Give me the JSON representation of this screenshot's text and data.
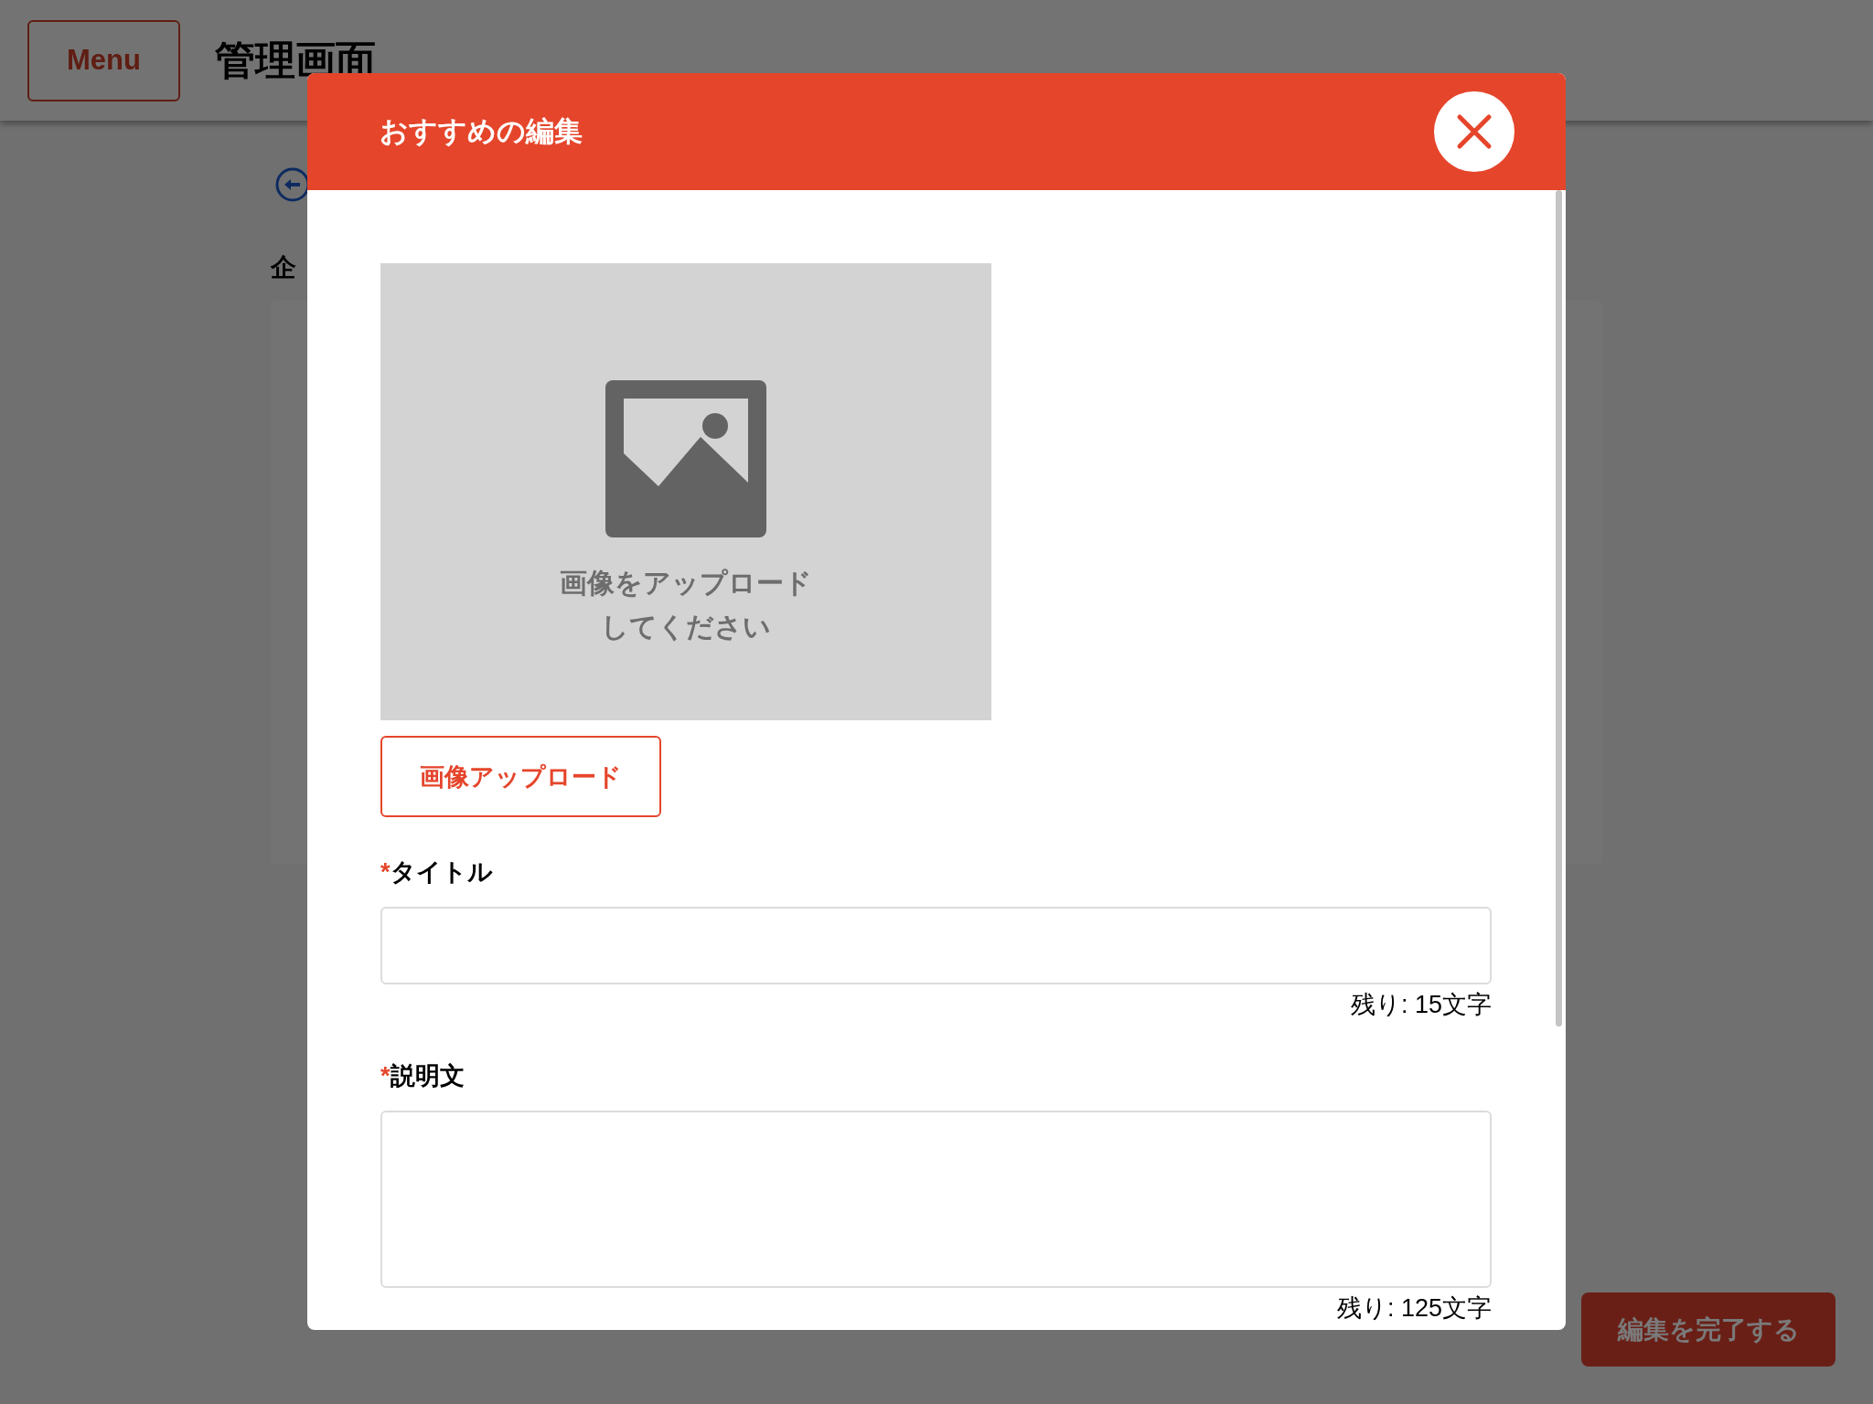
{
  "header": {
    "menu_button": "Menu",
    "title": "管理画面"
  },
  "page": {
    "section_heading": "企"
  },
  "modal": {
    "title": "おすすめの編集",
    "image_placeholder": [
      "画像をアップロード",
      "してください"
    ],
    "upload_button": "画像アップロード",
    "fields": [
      {
        "kind": "input",
        "marker": "*",
        "label": "タイトル",
        "counter": "残り: 15文字"
      },
      {
        "kind": "textarea",
        "marker": "*",
        "label": "説明文",
        "counter": "残り: 125文字"
      }
    ]
  },
  "footer_button": "編集を完了する"
}
